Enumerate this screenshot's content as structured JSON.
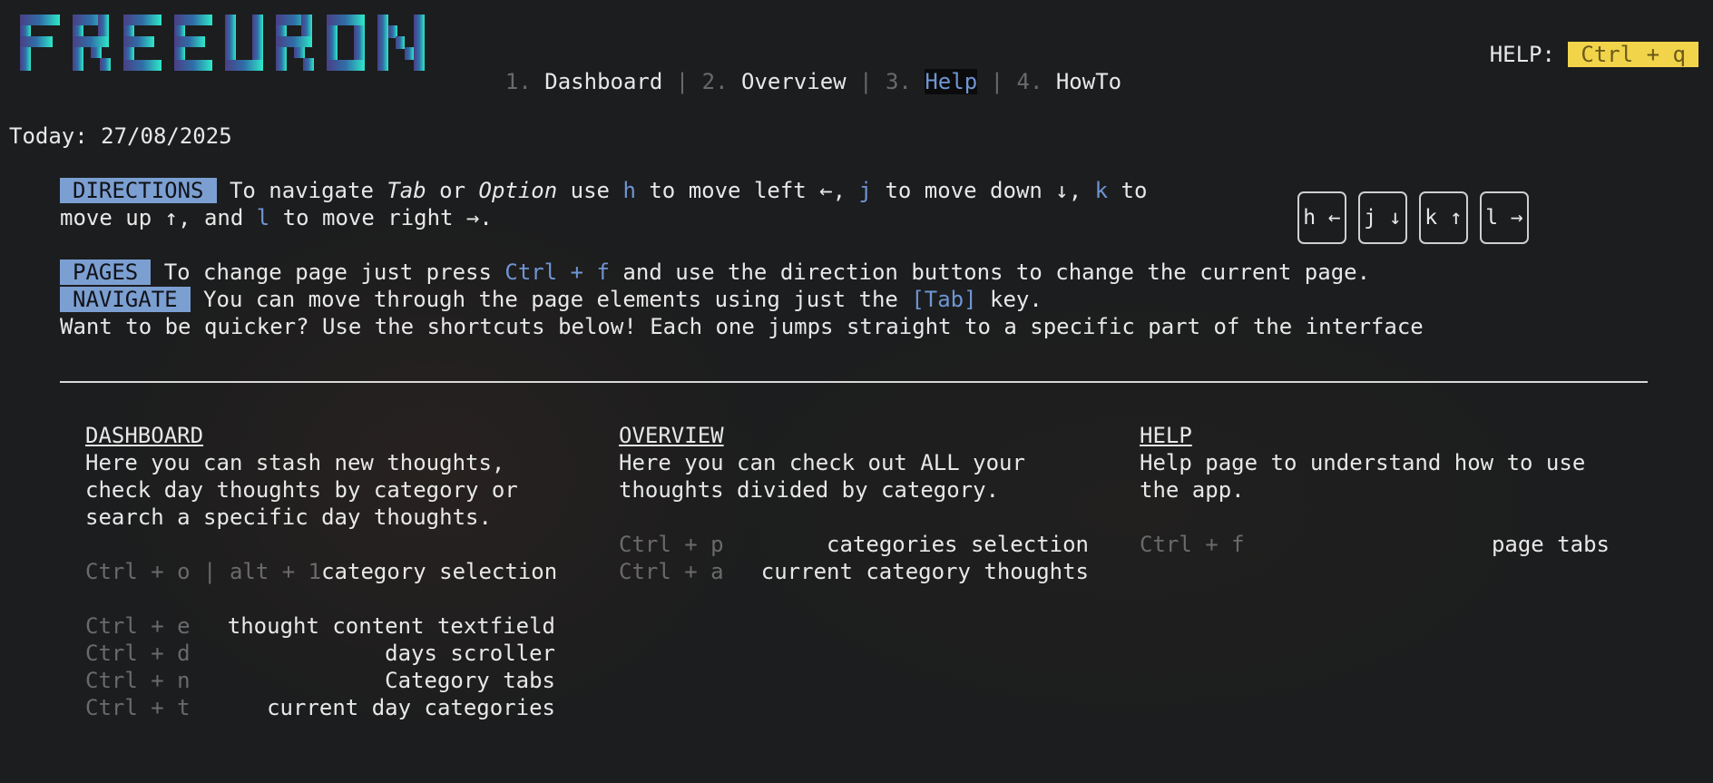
{
  "logo": {
    "text": "FREEURON"
  },
  "nav": {
    "items": [
      {
        "num": "1.",
        "label": "Dashboard",
        "active": false
      },
      {
        "num": "2.",
        "label": "Overview",
        "active": false
      },
      {
        "num": "3.",
        "label": "Help",
        "active": true
      },
      {
        "num": "4.",
        "label": "HowTo",
        "active": false
      }
    ],
    "separator": "|"
  },
  "help_hint": {
    "label": "HELP:",
    "shortcut": "Ctrl + q"
  },
  "today": "Today: 27/08/2025",
  "directions": {
    "tag": "DIRECTIONS",
    "t1": " To navigate ",
    "tab": "Tab",
    "t2": " or ",
    "option": "Option",
    "t3": " use ",
    "h": "h",
    "t4": " to move left ←, ",
    "j": "j",
    "t5": " to move down ↓, ",
    "k": "k",
    "t6": " to",
    "t7": "move up ↑, and ",
    "l": "l",
    "t8": " to move right →."
  },
  "keycaps": [
    "h ←",
    "j ↓",
    "k ↑",
    "l →"
  ],
  "pages": {
    "tag": "PAGES",
    "t1": " To change page just press ",
    "shortcut": "Ctrl + f",
    "t2": " and use the direction buttons to change the current page."
  },
  "navigate": {
    "tag": "NAVIGATE",
    "t1": " You can move through the page elements using just the ",
    "key": "[Tab]",
    "t2": " key."
  },
  "quicker": "Want to be quicker? Use the shortcuts below! Each one jumps straight to a specific part of the interface",
  "columns": {
    "dashboard": {
      "title": "DASHBOARD",
      "desc": [
        "Here you can stash new thoughts,",
        "check day thoughts by category or",
        "search a specific day thoughts."
      ],
      "shortcuts": [
        {
          "key": "Ctrl + o | alt + 1",
          "desc": "category selection"
        },
        {
          "key": "Ctrl + e",
          "desc": "thought content textfield"
        },
        {
          "key": "Ctrl + d",
          "desc": "days scroller"
        },
        {
          "key": "Ctrl + n",
          "desc": "Category tabs"
        },
        {
          "key": "Ctrl + t",
          "desc": "current day categories"
        }
      ]
    },
    "overview": {
      "title": "OVERVIEW",
      "desc": [
        "Here you can check out ALL your",
        "thoughts divided by category."
      ],
      "shortcuts": [
        {
          "key": "Ctrl + p",
          "desc": "categories selection"
        },
        {
          "key": "Ctrl + a",
          "desc": "current category thoughts"
        }
      ]
    },
    "help": {
      "title": "HELP",
      "desc": [
        "Help page to understand how to use",
        "the app."
      ],
      "shortcuts": [
        {
          "key": "Ctrl + f",
          "desc": "page tabs"
        }
      ]
    }
  },
  "colors": {
    "accent_blue": "#6f95d4",
    "tag_bg": "#7c9fd2",
    "help_badge": "#f2d44b",
    "logo_start": "#4a3f85",
    "logo_end": "#2ee8c8",
    "muted": "#6a6a6a"
  }
}
